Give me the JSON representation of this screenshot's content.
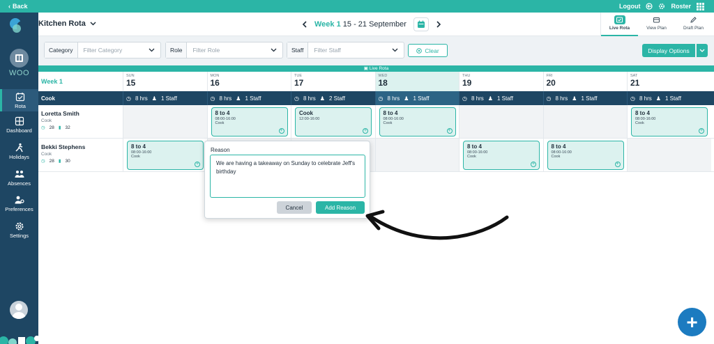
{
  "topbar": {
    "back": "Back",
    "logout": "Logout",
    "roster": "Roster"
  },
  "sidebar": {
    "brand": "WOO",
    "items": [
      {
        "label": "Rota",
        "icon": "calendar-icon"
      },
      {
        "label": "Dashboard",
        "icon": "dashboard-icon"
      },
      {
        "label": "Holidays",
        "icon": "holidays-icon"
      },
      {
        "label": "Absences",
        "icon": "absences-icon"
      },
      {
        "label": "Preferences",
        "icon": "preferences-icon"
      },
      {
        "label": "Settings",
        "icon": "settings-icon"
      }
    ]
  },
  "header": {
    "title": "Kitchen Rota",
    "week_label": "Week 1",
    "date_range": "15 - 21 September",
    "views": [
      {
        "label": "Live Rota",
        "active": true
      },
      {
        "label": "View Plan",
        "active": false
      },
      {
        "label": "Draft Plan",
        "active": false
      }
    ]
  },
  "filters": {
    "category_label": "Category",
    "category_placeholder": "Filter Category",
    "role_label": "Role",
    "role_placeholder": "Filter Role",
    "staff_label": "Staff",
    "staff_placeholder": "Filter Staff",
    "clear": "Clear",
    "display_options": "Display Options"
  },
  "live_rota_bar": "Live Rota",
  "grid": {
    "week_label": "Week 1",
    "days": [
      {
        "name": "SUN",
        "date": "15"
      },
      {
        "name": "MON",
        "date": "16"
      },
      {
        "name": "TUE",
        "date": "17"
      },
      {
        "name": "WED",
        "date": "18"
      },
      {
        "name": "THU",
        "date": "19"
      },
      {
        "name": "FRI",
        "date": "20"
      },
      {
        "name": "SAT",
        "date": "21"
      }
    ],
    "role_row": {
      "label": "Cook",
      "summaries": [
        {
          "hrs": "8 hrs",
          "staff": "1 Staff"
        },
        {
          "hrs": "8 hrs",
          "staff": "1 Staff"
        },
        {
          "hrs": "8 hrs",
          "staff": "2 Staff"
        },
        {
          "hrs": "8 hrs",
          "staff": "1 Staff"
        },
        {
          "hrs": "8 hrs",
          "staff": "1 Staff"
        },
        {
          "hrs": "8 hrs",
          "staff": "1 Staff"
        },
        {
          "hrs": "8 hrs",
          "staff": "1 Staff"
        }
      ]
    },
    "staff": [
      {
        "name": "Loretta Smith",
        "role": "Cook",
        "stat1": "28",
        "stat2": "32",
        "shifts": [
          null,
          {
            "title": "8 to 4",
            "time": "08:00-16:00",
            "role": "Cook"
          },
          {
            "title": "Cook",
            "time": "12:00-16:00",
            "role": ""
          },
          {
            "title": "8 to 4",
            "time": "08:00-16:00",
            "role": "Cook"
          },
          null,
          null,
          {
            "title": "8 to 4",
            "time": "08:00-16:00",
            "role": "Cook"
          }
        ]
      },
      {
        "name": "Bekki Stephens",
        "role": "Cook",
        "stat1": "28",
        "stat2": "30",
        "shifts": [
          {
            "title": "8 to 4",
            "time": "08:00-16:00",
            "role": "Cook"
          },
          null,
          null,
          null,
          {
            "title": "8 to 4",
            "time": "08:00-16:00",
            "role": "Cook"
          },
          {
            "title": "8 to 4",
            "time": "08:00-16:00",
            "role": "Cook"
          },
          null
        ]
      }
    ]
  },
  "popup": {
    "label": "Reason",
    "value": "We are having a takeaway on Sunday to celebrate Jeff's birthday",
    "cancel": "Cancel",
    "add": "Add Reason"
  },
  "colors": {
    "accent": "#2bb5a6",
    "sidebar": "#1e4663",
    "fab": "#1c7bc0"
  }
}
